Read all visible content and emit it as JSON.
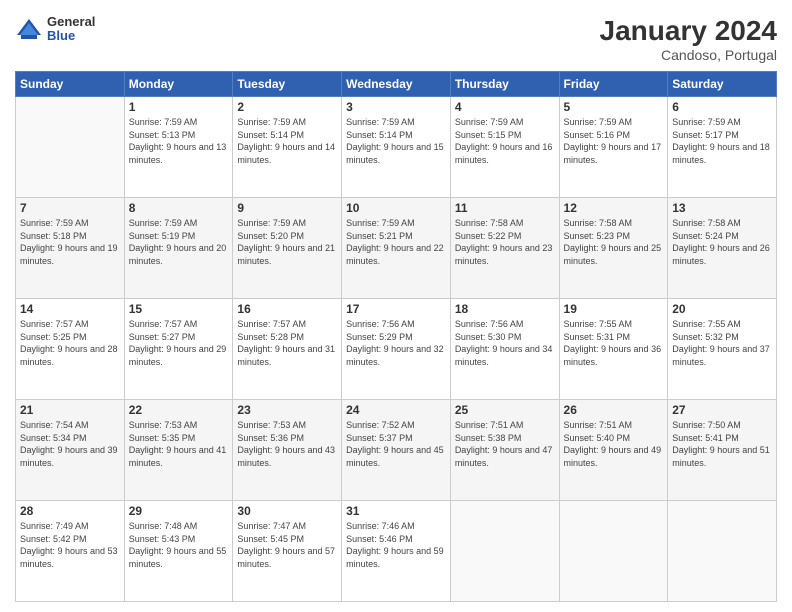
{
  "header": {
    "logo": {
      "general": "General",
      "blue": "Blue"
    },
    "title": "January 2024",
    "subtitle": "Candoso, Portugal"
  },
  "calendar": {
    "days_of_week": [
      "Sunday",
      "Monday",
      "Tuesday",
      "Wednesday",
      "Thursday",
      "Friday",
      "Saturday"
    ],
    "weeks": [
      [
        {
          "day": "",
          "sunrise": "",
          "sunset": "",
          "daylight": "",
          "empty": true
        },
        {
          "day": "1",
          "sunrise": "Sunrise: 7:59 AM",
          "sunset": "Sunset: 5:13 PM",
          "daylight": "Daylight: 9 hours and 13 minutes."
        },
        {
          "day": "2",
          "sunrise": "Sunrise: 7:59 AM",
          "sunset": "Sunset: 5:14 PM",
          "daylight": "Daylight: 9 hours and 14 minutes."
        },
        {
          "day": "3",
          "sunrise": "Sunrise: 7:59 AM",
          "sunset": "Sunset: 5:14 PM",
          "daylight": "Daylight: 9 hours and 15 minutes."
        },
        {
          "day": "4",
          "sunrise": "Sunrise: 7:59 AM",
          "sunset": "Sunset: 5:15 PM",
          "daylight": "Daylight: 9 hours and 16 minutes."
        },
        {
          "day": "5",
          "sunrise": "Sunrise: 7:59 AM",
          "sunset": "Sunset: 5:16 PM",
          "daylight": "Daylight: 9 hours and 17 minutes."
        },
        {
          "day": "6",
          "sunrise": "Sunrise: 7:59 AM",
          "sunset": "Sunset: 5:17 PM",
          "daylight": "Daylight: 9 hours and 18 minutes."
        }
      ],
      [
        {
          "day": "7",
          "sunrise": "Sunrise: 7:59 AM",
          "sunset": "Sunset: 5:18 PM",
          "daylight": "Daylight: 9 hours and 19 minutes."
        },
        {
          "day": "8",
          "sunrise": "Sunrise: 7:59 AM",
          "sunset": "Sunset: 5:19 PM",
          "daylight": "Daylight: 9 hours and 20 minutes."
        },
        {
          "day": "9",
          "sunrise": "Sunrise: 7:59 AM",
          "sunset": "Sunset: 5:20 PM",
          "daylight": "Daylight: 9 hours and 21 minutes."
        },
        {
          "day": "10",
          "sunrise": "Sunrise: 7:59 AM",
          "sunset": "Sunset: 5:21 PM",
          "daylight": "Daylight: 9 hours and 22 minutes."
        },
        {
          "day": "11",
          "sunrise": "Sunrise: 7:58 AM",
          "sunset": "Sunset: 5:22 PM",
          "daylight": "Daylight: 9 hours and 23 minutes."
        },
        {
          "day": "12",
          "sunrise": "Sunrise: 7:58 AM",
          "sunset": "Sunset: 5:23 PM",
          "daylight": "Daylight: 9 hours and 25 minutes."
        },
        {
          "day": "13",
          "sunrise": "Sunrise: 7:58 AM",
          "sunset": "Sunset: 5:24 PM",
          "daylight": "Daylight: 9 hours and 26 minutes."
        }
      ],
      [
        {
          "day": "14",
          "sunrise": "Sunrise: 7:57 AM",
          "sunset": "Sunset: 5:25 PM",
          "daylight": "Daylight: 9 hours and 28 minutes."
        },
        {
          "day": "15",
          "sunrise": "Sunrise: 7:57 AM",
          "sunset": "Sunset: 5:27 PM",
          "daylight": "Daylight: 9 hours and 29 minutes."
        },
        {
          "day": "16",
          "sunrise": "Sunrise: 7:57 AM",
          "sunset": "Sunset: 5:28 PM",
          "daylight": "Daylight: 9 hours and 31 minutes."
        },
        {
          "day": "17",
          "sunrise": "Sunrise: 7:56 AM",
          "sunset": "Sunset: 5:29 PM",
          "daylight": "Daylight: 9 hours and 32 minutes."
        },
        {
          "day": "18",
          "sunrise": "Sunrise: 7:56 AM",
          "sunset": "Sunset: 5:30 PM",
          "daylight": "Daylight: 9 hours and 34 minutes."
        },
        {
          "day": "19",
          "sunrise": "Sunrise: 7:55 AM",
          "sunset": "Sunset: 5:31 PM",
          "daylight": "Daylight: 9 hours and 36 minutes."
        },
        {
          "day": "20",
          "sunrise": "Sunrise: 7:55 AM",
          "sunset": "Sunset: 5:32 PM",
          "daylight": "Daylight: 9 hours and 37 minutes."
        }
      ],
      [
        {
          "day": "21",
          "sunrise": "Sunrise: 7:54 AM",
          "sunset": "Sunset: 5:34 PM",
          "daylight": "Daylight: 9 hours and 39 minutes."
        },
        {
          "day": "22",
          "sunrise": "Sunrise: 7:53 AM",
          "sunset": "Sunset: 5:35 PM",
          "daylight": "Daylight: 9 hours and 41 minutes."
        },
        {
          "day": "23",
          "sunrise": "Sunrise: 7:53 AM",
          "sunset": "Sunset: 5:36 PM",
          "daylight": "Daylight: 9 hours and 43 minutes."
        },
        {
          "day": "24",
          "sunrise": "Sunrise: 7:52 AM",
          "sunset": "Sunset: 5:37 PM",
          "daylight": "Daylight: 9 hours and 45 minutes."
        },
        {
          "day": "25",
          "sunrise": "Sunrise: 7:51 AM",
          "sunset": "Sunset: 5:38 PM",
          "daylight": "Daylight: 9 hours and 47 minutes."
        },
        {
          "day": "26",
          "sunrise": "Sunrise: 7:51 AM",
          "sunset": "Sunset: 5:40 PM",
          "daylight": "Daylight: 9 hours and 49 minutes."
        },
        {
          "day": "27",
          "sunrise": "Sunrise: 7:50 AM",
          "sunset": "Sunset: 5:41 PM",
          "daylight": "Daylight: 9 hours and 51 minutes."
        }
      ],
      [
        {
          "day": "28",
          "sunrise": "Sunrise: 7:49 AM",
          "sunset": "Sunset: 5:42 PM",
          "daylight": "Daylight: 9 hours and 53 minutes."
        },
        {
          "day": "29",
          "sunrise": "Sunrise: 7:48 AM",
          "sunset": "Sunset: 5:43 PM",
          "daylight": "Daylight: 9 hours and 55 minutes."
        },
        {
          "day": "30",
          "sunrise": "Sunrise: 7:47 AM",
          "sunset": "Sunset: 5:45 PM",
          "daylight": "Daylight: 9 hours and 57 minutes."
        },
        {
          "day": "31",
          "sunrise": "Sunrise: 7:46 AM",
          "sunset": "Sunset: 5:46 PM",
          "daylight": "Daylight: 9 hours and 59 minutes."
        },
        {
          "day": "",
          "sunrise": "",
          "sunset": "",
          "daylight": "",
          "empty": true
        },
        {
          "day": "",
          "sunrise": "",
          "sunset": "",
          "daylight": "",
          "empty": true
        },
        {
          "day": "",
          "sunrise": "",
          "sunset": "",
          "daylight": "",
          "empty": true
        }
      ]
    ]
  }
}
